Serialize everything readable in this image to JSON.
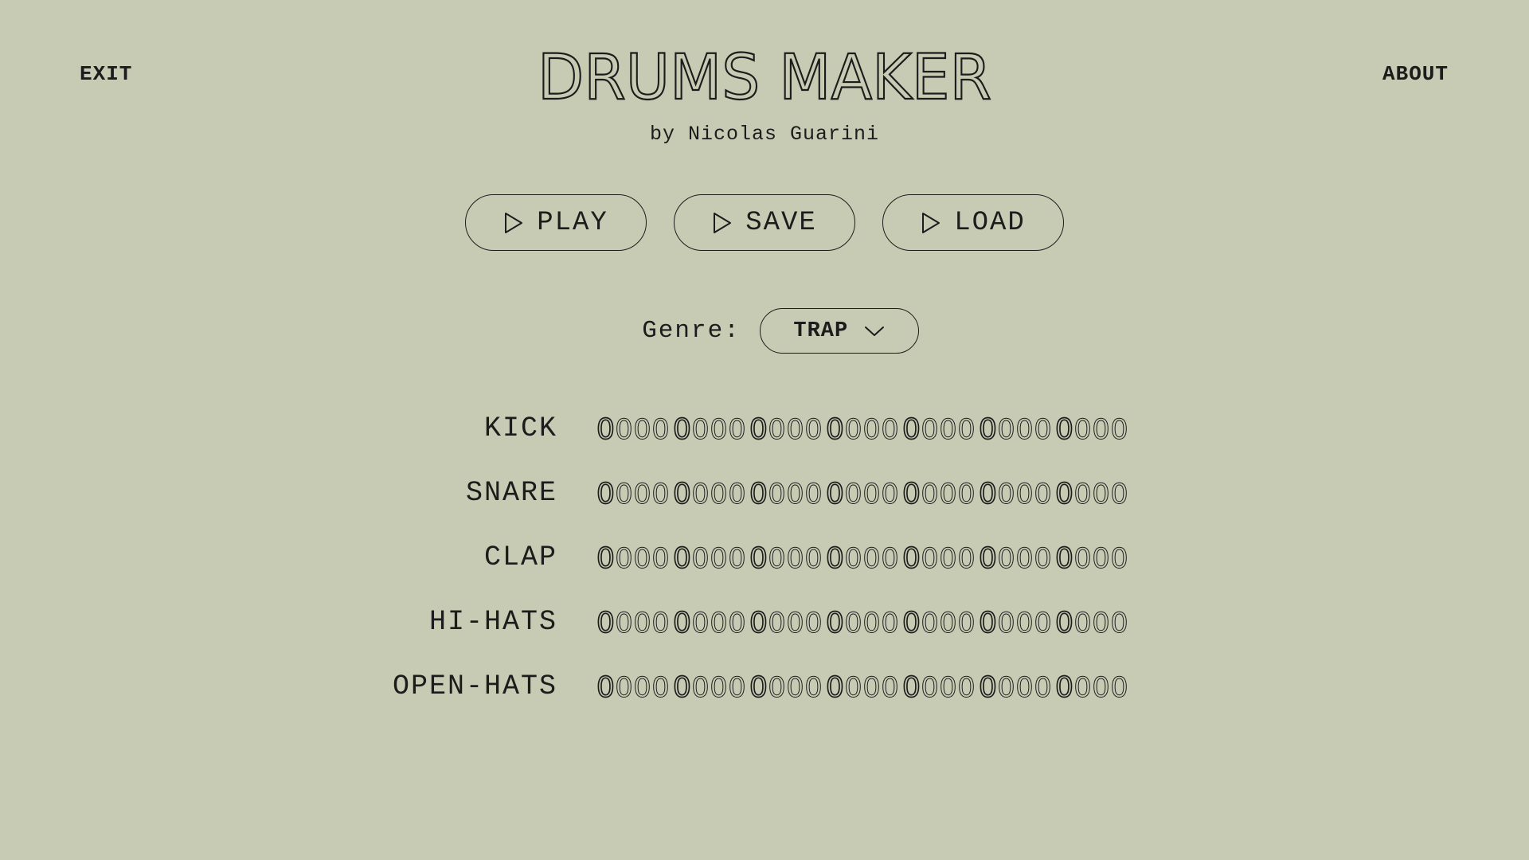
{
  "nav": {
    "exit_label": "EXIT",
    "about_label": "ABOUT"
  },
  "header": {
    "title": "DRUMS MAKER",
    "subtitle": "by Nicolas Guarini"
  },
  "controls": {
    "play_label": "PLAY",
    "save_label": "SAVE",
    "load_label": "LOAD"
  },
  "genre": {
    "label": "Genre:",
    "selected": "TRAP"
  },
  "sequencer": {
    "step_glyph": "0",
    "steps_per_track": 28,
    "tracks": [
      {
        "name": "KICK"
      },
      {
        "name": "SNARE"
      },
      {
        "name": "CLAP"
      },
      {
        "name": "HI-HATS"
      },
      {
        "name": "OPEN-HATS"
      }
    ]
  },
  "colors": {
    "background": "#c8cbb3",
    "ink": "#1c1c1c"
  },
  "icons": {
    "play_button": "play-triangle-icon",
    "save_button": "play-triangle-icon",
    "load_button": "play-triangle-icon",
    "genre_select": "chevron-down-icon"
  }
}
